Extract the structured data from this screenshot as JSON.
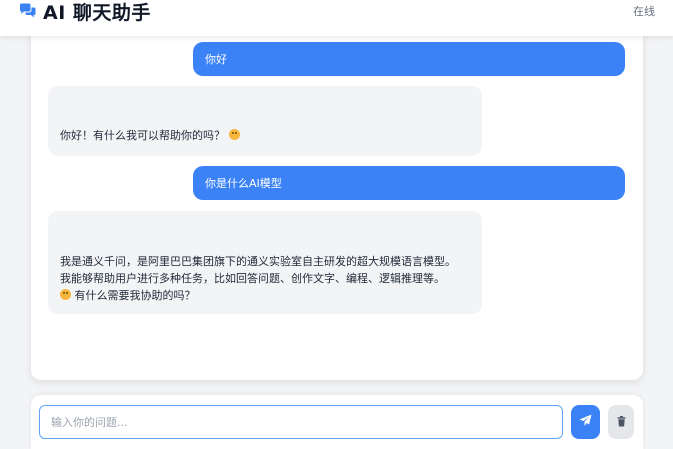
{
  "header": {
    "icon": "comments-icon",
    "title": "AI 聊天助手",
    "status": "在线"
  },
  "messages": [
    {
      "role": "user",
      "text": "你好"
    },
    {
      "role": "assistant",
      "text": "你好！有什么我可以帮助你的吗？",
      "trailing_emoji": "smile-emoji"
    },
    {
      "role": "user",
      "text": "你是什么AI模型"
    },
    {
      "role": "assistant",
      "line1": "我是通义千问，是阿里巴巴集团旗下的通义实验室自主研发的超大规模语言模型。",
      "line2": "我能够帮助用户进行多种任务，比如回答问题、创作文字、编程、逻辑推理等。",
      "line3": "有什么需要我协助的吗？",
      "leading_emoji": "smile-emoji"
    }
  ],
  "composer": {
    "placeholder": "输入你的问题...",
    "value": "",
    "send_icon": "paper-plane-icon",
    "clear_icon": "trash-icon"
  },
  "colors": {
    "accent": "#3b82f6",
    "bot_bubble": "#f3f4f6",
    "background": "#f3f4f6"
  }
}
